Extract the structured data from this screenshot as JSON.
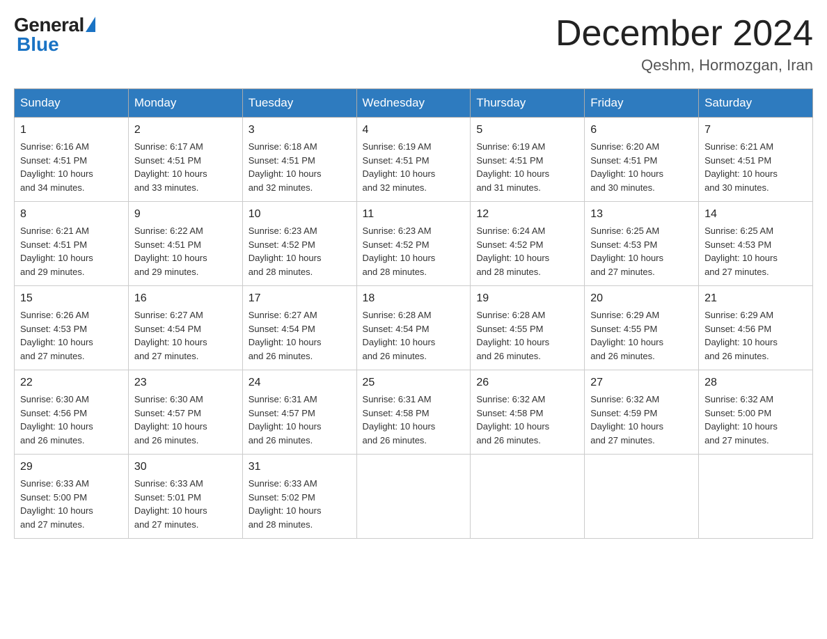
{
  "logo": {
    "general": "General",
    "blue": "Blue"
  },
  "header": {
    "month": "December 2024",
    "location": "Qeshm, Hormozgan, Iran"
  },
  "weekdays": [
    "Sunday",
    "Monday",
    "Tuesday",
    "Wednesday",
    "Thursday",
    "Friday",
    "Saturday"
  ],
  "weeks": [
    [
      {
        "day": "1",
        "sunrise": "6:16 AM",
        "sunset": "4:51 PM",
        "daylight": "10 hours and 34 minutes."
      },
      {
        "day": "2",
        "sunrise": "6:17 AM",
        "sunset": "4:51 PM",
        "daylight": "10 hours and 33 minutes."
      },
      {
        "day": "3",
        "sunrise": "6:18 AM",
        "sunset": "4:51 PM",
        "daylight": "10 hours and 32 minutes."
      },
      {
        "day": "4",
        "sunrise": "6:19 AM",
        "sunset": "4:51 PM",
        "daylight": "10 hours and 32 minutes."
      },
      {
        "day": "5",
        "sunrise": "6:19 AM",
        "sunset": "4:51 PM",
        "daylight": "10 hours and 31 minutes."
      },
      {
        "day": "6",
        "sunrise": "6:20 AM",
        "sunset": "4:51 PM",
        "daylight": "10 hours and 30 minutes."
      },
      {
        "day": "7",
        "sunrise": "6:21 AM",
        "sunset": "4:51 PM",
        "daylight": "10 hours and 30 minutes."
      }
    ],
    [
      {
        "day": "8",
        "sunrise": "6:21 AM",
        "sunset": "4:51 PM",
        "daylight": "10 hours and 29 minutes."
      },
      {
        "day": "9",
        "sunrise": "6:22 AM",
        "sunset": "4:51 PM",
        "daylight": "10 hours and 29 minutes."
      },
      {
        "day": "10",
        "sunrise": "6:23 AM",
        "sunset": "4:52 PM",
        "daylight": "10 hours and 28 minutes."
      },
      {
        "day": "11",
        "sunrise": "6:23 AM",
        "sunset": "4:52 PM",
        "daylight": "10 hours and 28 minutes."
      },
      {
        "day": "12",
        "sunrise": "6:24 AM",
        "sunset": "4:52 PM",
        "daylight": "10 hours and 28 minutes."
      },
      {
        "day": "13",
        "sunrise": "6:25 AM",
        "sunset": "4:53 PM",
        "daylight": "10 hours and 27 minutes."
      },
      {
        "day": "14",
        "sunrise": "6:25 AM",
        "sunset": "4:53 PM",
        "daylight": "10 hours and 27 minutes."
      }
    ],
    [
      {
        "day": "15",
        "sunrise": "6:26 AM",
        "sunset": "4:53 PM",
        "daylight": "10 hours and 27 minutes."
      },
      {
        "day": "16",
        "sunrise": "6:27 AM",
        "sunset": "4:54 PM",
        "daylight": "10 hours and 27 minutes."
      },
      {
        "day": "17",
        "sunrise": "6:27 AM",
        "sunset": "4:54 PM",
        "daylight": "10 hours and 26 minutes."
      },
      {
        "day": "18",
        "sunrise": "6:28 AM",
        "sunset": "4:54 PM",
        "daylight": "10 hours and 26 minutes."
      },
      {
        "day": "19",
        "sunrise": "6:28 AM",
        "sunset": "4:55 PM",
        "daylight": "10 hours and 26 minutes."
      },
      {
        "day": "20",
        "sunrise": "6:29 AM",
        "sunset": "4:55 PM",
        "daylight": "10 hours and 26 minutes."
      },
      {
        "day": "21",
        "sunrise": "6:29 AM",
        "sunset": "4:56 PM",
        "daylight": "10 hours and 26 minutes."
      }
    ],
    [
      {
        "day": "22",
        "sunrise": "6:30 AM",
        "sunset": "4:56 PM",
        "daylight": "10 hours and 26 minutes."
      },
      {
        "day": "23",
        "sunrise": "6:30 AM",
        "sunset": "4:57 PM",
        "daylight": "10 hours and 26 minutes."
      },
      {
        "day": "24",
        "sunrise": "6:31 AM",
        "sunset": "4:57 PM",
        "daylight": "10 hours and 26 minutes."
      },
      {
        "day": "25",
        "sunrise": "6:31 AM",
        "sunset": "4:58 PM",
        "daylight": "10 hours and 26 minutes."
      },
      {
        "day": "26",
        "sunrise": "6:32 AM",
        "sunset": "4:58 PM",
        "daylight": "10 hours and 26 minutes."
      },
      {
        "day": "27",
        "sunrise": "6:32 AM",
        "sunset": "4:59 PM",
        "daylight": "10 hours and 27 minutes."
      },
      {
        "day": "28",
        "sunrise": "6:32 AM",
        "sunset": "5:00 PM",
        "daylight": "10 hours and 27 minutes."
      }
    ],
    [
      {
        "day": "29",
        "sunrise": "6:33 AM",
        "sunset": "5:00 PM",
        "daylight": "10 hours and 27 minutes."
      },
      {
        "day": "30",
        "sunrise": "6:33 AM",
        "sunset": "5:01 PM",
        "daylight": "10 hours and 27 minutes."
      },
      {
        "day": "31",
        "sunrise": "6:33 AM",
        "sunset": "5:02 PM",
        "daylight": "10 hours and 28 minutes."
      },
      null,
      null,
      null,
      null
    ]
  ],
  "labels": {
    "sunrise": "Sunrise:",
    "sunset": "Sunset:",
    "daylight": "Daylight:"
  }
}
